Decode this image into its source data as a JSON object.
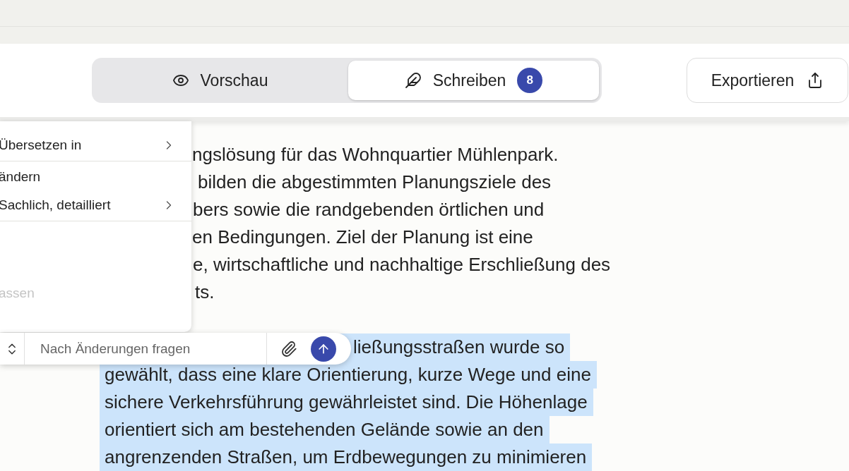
{
  "tabs": [
    {
      "label": "Vorschau",
      "selected": false
    },
    {
      "label": "Schreiben",
      "selected": true,
      "badge": "8"
    }
  ],
  "export_button": {
    "label": "Exportieren"
  },
  "document": {
    "paragraphs": [
      {
        "selected": false,
        "lines": [
          "ngslösung für das Wohnquartier Mühlenpark.",
          "bilden die abgestimmten Planungsziele des",
          "bers sowie die randgebenden örtlichen und",
          "en Bedingungen. Ziel der Planung ist eine",
          "e, wirtschaftliche und nachhaltige Erschließung des",
          "ts."
        ]
      },
      {
        "selected": true,
        "lines": [
          "ließungsstraßen wurde so",
          "gewählt, dass eine klare Orientierung, kurze Wege und eine",
          "sichere Verkehrsführung gewährleistet sind. Die Höhenlage",
          "orientiert sich am bestehenden Gelände sowie an den",
          "angrenzenden Straßen, um Erdbewegungen zu minimieren"
        ]
      }
    ]
  },
  "menu": {
    "items": [
      {
        "kind": "submenu",
        "label": "Übersetzen in",
        "disabled": false
      },
      {
        "kind": "divider"
      },
      {
        "kind": "heading",
        "label": "ändern"
      },
      {
        "kind": "submenu",
        "label": "Sachlich, detailliert",
        "disabled": false
      },
      {
        "kind": "divider"
      },
      {
        "kind": "spacer"
      },
      {
        "kind": "item",
        "label": "assen",
        "disabled": true
      }
    ]
  },
  "chat_input": {
    "placeholder": "Nach Änderungen fragen"
  }
}
